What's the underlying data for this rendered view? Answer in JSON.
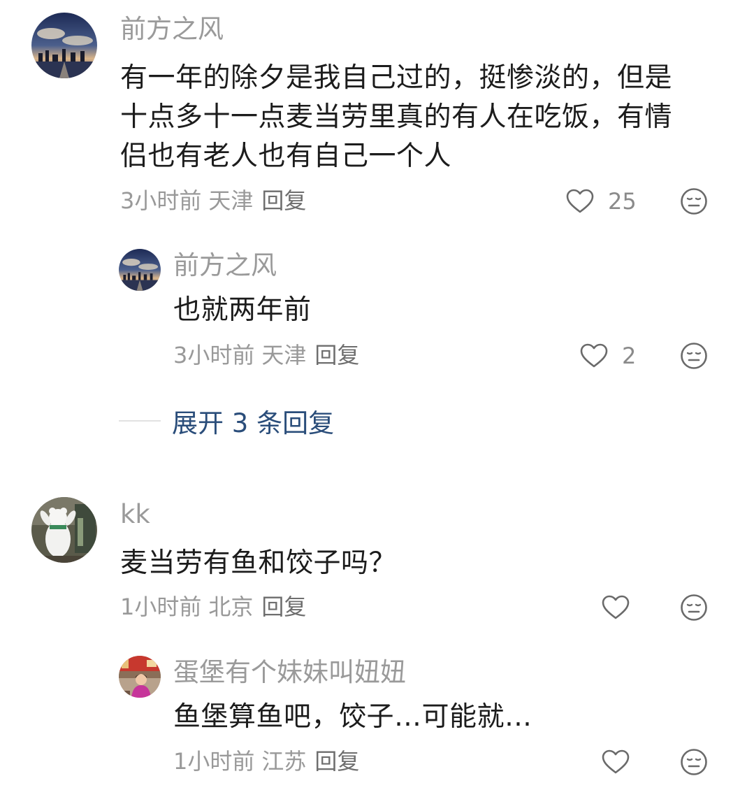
{
  "comments": [
    {
      "username": "前方之风",
      "avatar": "night-city-avatar",
      "content_lines": [
        "有一年的除夕是我自己过的，挺惨淡的，但是",
        "十点多十一点麦当劳里真的有人在吃饭，有情",
        "侣也有老人也有自己一个人"
      ],
      "time": "3小时前",
      "location": "天津",
      "reply_label": "回复",
      "like_count": "25"
    },
    {
      "username": "前方之风",
      "avatar": "night-city-avatar",
      "content_lines": [
        "也就两年前"
      ],
      "time": "3小时前",
      "location": "天津",
      "reply_label": "回复",
      "like_count": "2"
    },
    {
      "username": "kk",
      "avatar": "bear-mascot-avatar",
      "content_lines": [
        "麦当劳有鱼和饺子吗？"
      ],
      "time": "1小时前",
      "location": "北京",
      "reply_label": "回复",
      "like_count": ""
    },
    {
      "username": "蛋堡有个妹妹叫妞妞",
      "avatar": "girl-photo-avatar",
      "content_lines": [
        "鱼堡算鱼吧，饺子…可能就…"
      ],
      "time": "1小时前",
      "location": "江苏",
      "reply_label": "回复",
      "like_count": ""
    }
  ],
  "expand_replies": {
    "label": "展开 3 条回复"
  },
  "icons": {
    "like": "heart-outline-icon",
    "react": "neutral-face-icon"
  },
  "colors": {
    "username": "#9a9a9a",
    "text": "#1c1c1c",
    "meta": "#999999",
    "expand": "#2a4d7a"
  }
}
